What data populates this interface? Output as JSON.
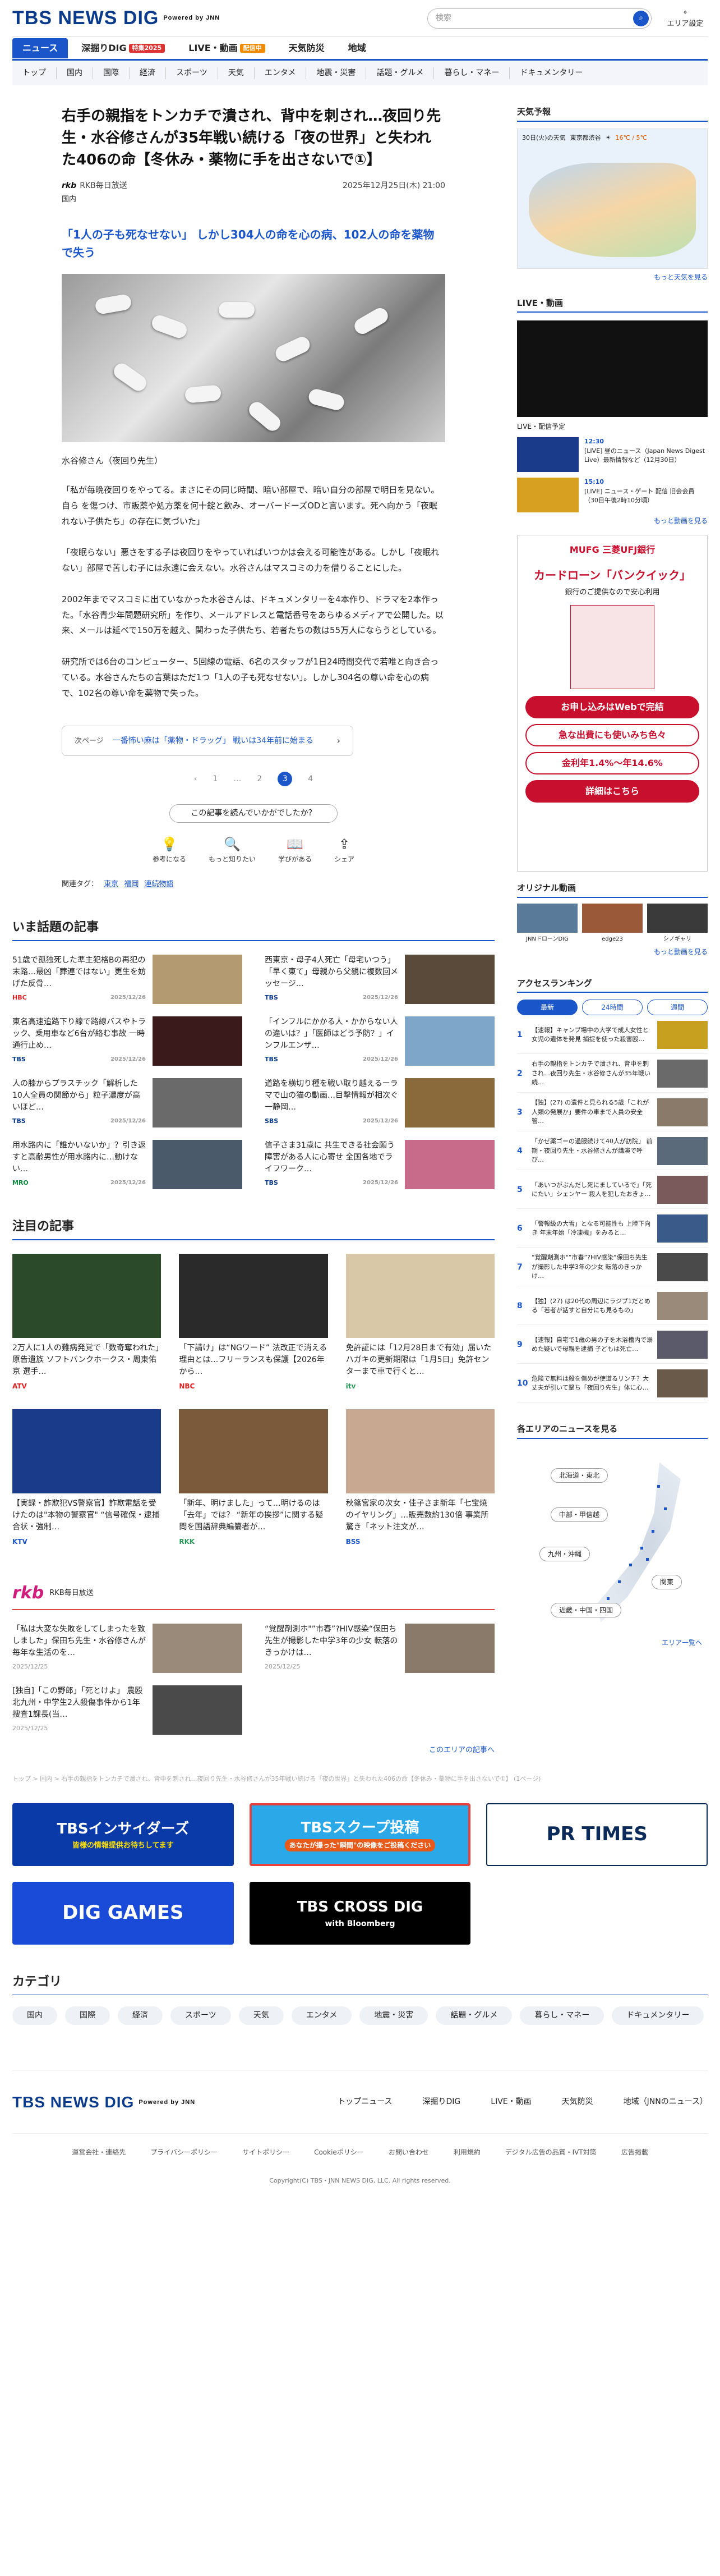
{
  "header": {
    "logo": "TBS NEWS DIG",
    "logo_sub": "Powered by JNN",
    "search_placeholder": "検索",
    "area_label": "エリア設定"
  },
  "gnav": [
    {
      "label": "ニュース",
      "badge": ""
    },
    {
      "label": "深掘りDIG",
      "badge": "特集2025"
    },
    {
      "label": "LIVE・動画",
      "badge": "配信中"
    },
    {
      "label": "天気防災",
      "badge": ""
    },
    {
      "label": "地域",
      "badge": ""
    }
  ],
  "snav": [
    "トップ",
    "国内",
    "国際",
    "経済",
    "スポーツ",
    "天気",
    "エンタメ",
    "地震・災害",
    "話題・グルメ",
    "暮らし・マネー",
    "ドキュメンタリー"
  ],
  "article": {
    "title": "右手の親指をトンカチで潰され、背中を刺され…夜回り先生・水谷修さんが35年戦い続ける「夜の世界」と失われた406の命【冬休み・薬物に手を出さないで①】",
    "source": "RKB毎日放送",
    "date": "2025年12月25日(木) 21:00",
    "category": "国内",
    "lead": "「1人の子も死なせない」 しかし304人の命を心の病、102人の命を薬物で失う",
    "caption": "水谷修さん（夜回り先生）",
    "paragraphs": [
      "「私が毎晩夜回りをやってる。まさにその同じ時間、暗い部屋で、暗い自分の部屋で明日を見ない。自ら を傷つけ、市販薬や処方薬を何十錠と飲み、オーバードーズODと言います。死へ向かう「夜眠れない子供たち」の存在に気づいた」",
      "「夜眠らない」悪さをする子は夜回りをやっていればいつかは会える可能性がある。しかし「夜眠れない」部屋で苦しむ子には永遠に会えない。水谷さんはマスコミの力を借りることにした。",
      "2002年までマスコミに出ていなかった水谷さんは、ドキュメンタリーを4本作り、ドラマを2本作った。「水谷青少年問題研究所」を作り、メールアドレスと電話番号をあらゆるメディアで公開した。以来、メールは延べで150万を越え、関わった子供たち、若者たちの数は55万人にならうとしている。",
      "研究所では6台のコンピューター、5回線の電話、6名のスタッフが1日24時間交代で若唯と向き合っている。水谷さんたちの言葉はただ1つ「1人の子も死なせない」。しかし304名の尊い命を心の病で、102名の尊い命を薬物で失った。"
    ],
    "next_label": "次ページ",
    "next_text": "一番怖い麻は「薬物・ドラッグ」 戦いは34年前に始まる",
    "pages": [
      "1",
      "2",
      "3",
      "4"
    ],
    "current_page": "3",
    "feedback": "この記事を読んでいかがでしたか？",
    "reactions": [
      "参考になる",
      "もっと知りたい",
      "学びがある",
      "シェア"
    ],
    "tags_label": "関連タグ：",
    "tags": [
      "東京",
      "福岡",
      "連続物語"
    ]
  },
  "topics": {
    "title": "いま話題の記事",
    "items": [
      {
        "title": "51歳で孤独死した準主犯格Bの再犯の末路…最凶「葬連ではない」更生を妨げた反骨…",
        "source": "HBC",
        "date": "2025/12/26"
      },
      {
        "title": "西東京・母子4人死亡「母宅いつう」「早く東て」母親から父親に複数回メッセージ…",
        "source": "TBS",
        "date": "2025/12/26"
      },
      {
        "title": "東名高速追路下り線で路線バスやトラック、乗用車など6台が絡む事故 一時通行止め…",
        "source": "TBS",
        "date": "2025/12/26"
      },
      {
        "title": "「インフルにかかる人・かからない人の違いは？」「医師はどう予防？」インフルエンザ…",
        "source": "TBS",
        "date": "2025/12/26"
      },
      {
        "title": "人の膝からプラスチック「解析した10人全員の関節から」粒子濃度が高いほど…",
        "source": "TBS",
        "date": "2025/12/26"
      },
      {
        "title": "道路を横切り種を戦い取り越えるーラマで山の猫の動画…目撃情報が相次ぐ一静岡…",
        "source": "SBS",
        "date": "2025/12/26"
      },
      {
        "title": "用水路内に「誰かいないか」？引き返すと高齢男性が用水路内に…動けない…",
        "source": "MRO",
        "date": "2025/12/26"
      },
      {
        "title": "信子さま31歳に 共生できる社会願う 障害がある人に心寄せ 全国各地でライフワーク…",
        "source": "TBS",
        "date": "2025/12/26"
      }
    ]
  },
  "featured": {
    "title": "注目の記事",
    "cards": [
      {
        "title": "2万人に1人の難病発覚で「数奇奪われた」原告遺族 ソフトバンクホークス・周東佑京 選手…",
        "source": "ATV",
        "date": "12時間前"
      },
      {
        "title": "「下請け」は“NGワード” 法改正で消える理由とは…フリーランスも保護【2026年から…",
        "source": "NBC",
        "date": "12時間前"
      },
      {
        "title": "免許証には「12月28日まで有効」届いたハガキの更新期限は「1月5日」免許センターまで車で行くと…",
        "source": "itv",
        "date": "12時間前"
      },
      {
        "title": "【実録・詐欺犯VS警察官】詐欺電話を受けたのは\"本物の警察官\" “信号確保・逮捕合状・強制…",
        "source": "KTV",
        "date": "12時間前"
      },
      {
        "title": "「新年、明けました」って…明けるのは「去年」では？ “新年の挨拶”に関する疑問を国語辞典編纂者が…",
        "source": "RKK",
        "date": "12時間前"
      },
      {
        "title": "秋篠宮家の次女・佳子さま新年「七宝焼のイヤリング」…販売数約130倍 事業所驚き「ネット注文が…",
        "source": "BSS",
        "date": "12時間前"
      }
    ]
  },
  "rkb": {
    "brand": "rkb",
    "label": "RKB毎日放送",
    "items": [
      {
        "title": "「私は大変な失敗をしてしまったを致しました」保田ち先生・水谷修さんが毎年な生活のを…",
        "date": "2025/12/25"
      },
      {
        "title": "“覚醒剤測ホ\"”市春”?HIV感染“保田ち先生が撮影した中学3年の少女 転落のきっかけは…",
        "date": "2025/12/25"
      },
      {
        "title": "[独自]「この野郎」「死とけよ」 農殴 北九州・中学生2人殺傷事件から1年 捜査1課長(当…",
        "date": "2025/12/25"
      }
    ],
    "more": "このエリアの記事へ"
  },
  "ticker": "トップ > 国内 > 右手の親指をトンカチで潰され、背中を刺され…夜回り先生・水谷修さんが35年戦い続ける「夜の世界」と失われた406の命【冬休み・薬物に手を出さないで①】 (1ページ)",
  "banners": [
    {
      "label": "TBSインサイダーズ",
      "sub": "皆様の情報提供お待ちしてます"
    },
    {
      "label": "TBSスクープ投稿",
      "sub": "あなたが撮った\"瞬間\"の映像をご投稿ください"
    },
    {
      "label": "PR TIMES",
      "sub": ""
    },
    {
      "label": "DIG GAMES",
      "sub": ""
    },
    {
      "label": "TBS CROSS DIG",
      "sub": "with Bloomberg"
    }
  ],
  "categories": {
    "title": "カテゴリ",
    "items": [
      "国内",
      "国際",
      "経済",
      "スポーツ",
      "天気",
      "エンタメ",
      "地震・災害",
      "話題・グルメ",
      "暮らし・マネー",
      "ドキュメンタリー"
    ]
  },
  "sidebar": {
    "weather_title": "天気予報",
    "weather_date": "30日(火)の天気",
    "weather_city": "東京都渋谷",
    "weather_temp": "16℃ / 5℃",
    "weather_more": "もっと天気を見る",
    "live_title": "LIVE・動画",
    "live_sub": "LIVE・配信予定",
    "live_items": [
      {
        "title": "[LIVE] 昼のニュース（Japan News Digest Live）最新情報など（12月30日）",
        "time": "12:30"
      },
      {
        "title": "[LIVE] ニュース・ゲート 配信 旧会会員（30日午後2時10分頃）",
        "time": "15:10"
      }
    ],
    "live_more": "もっと動画を見る",
    "ad_brand": "MUFG 三菱UFJ銀行",
    "ad_head": "カードローン「バンクイック」",
    "ad_sub": "銀行のご提供なので安心利用",
    "ad_btn1": "お申し込みはWebで完結",
    "ad_btn2": "急な出費にも使いみち色々",
    "ad_btn3": "金利年1.4%〜年14.6%",
    "ad_btn4": "詳細はこちら",
    "orig_title": "オリジナル動画",
    "orig_items": [
      "JNNドローンDIG",
      "edge23",
      "シノギャリ"
    ],
    "orig_more": "もっと動画を見る",
    "rank_title": "アクセスランキング",
    "rank_tabs": [
      "最新",
      "24時間",
      "週間"
    ],
    "ranks": [
      "【速報】キャンプ場中の大学で成人女性と女児の遺体を発見 捕捉を使った殺害殴…",
      "右手の親指をトンカチで潰され、背中を刺され…夜回り先生・水谷修さんが35年戦い続…",
      "【独】(27) の遺件と見られる5歳「これが人類の発展か」要件の車まで人員の安全管…",
      "「かぜ薬ゴーの過服続けて40人が訪院」 前期・夜回り先生・水谷修さんが講演で呼び…",
      "「あいつがぶんだし死にましているで」「死にたい」シェンヤー 殺人を犯したおきょ…",
      "「警報級の大雪」となる可能性も 上陸下向き 年末年始「冷凍機」をみると…",
      "“覚醒剤測ホ\"”市春”?HIV感染“保田ち先生が撮影した中学3年の少女 転落のきっかけ…",
      "【独】(27) は20代の周辺にラジプ1だとめる「若者が話すと自分にも見るもの」",
      "【速報】自宅で1歳の男の子を木浴槽内で溺めた疑いで母親を逮捕 子どもは死亡…",
      "危険で無料は殺を傷めが使道るリンチ？大丈夫が引いて撃ち「夜回り先生」体に心…"
    ],
    "area_title": "各エリアのニュースを見る",
    "area_pills": [
      "北海道・東北",
      "中部・甲信越",
      "九州・沖縄",
      "関東",
      "近畿・中国・四国"
    ],
    "area_more": "エリア一覧へ"
  },
  "footer": {
    "links": [
      "トップニュース",
      "深掘りDIG",
      "LIVE・動画",
      "天気防災",
      "地域（JNNのニュース）"
    ],
    "sub": [
      "運営会社・連絡先",
      "プライバシーポリシー",
      "サイトポリシー",
      "Cookieポリシー",
      "お問い合わせ",
      "利用規約",
      "デジタル広告の品質・IVT対策",
      "広告掲載"
    ],
    "copyright": "Copyright(C) TBS・JNN NEWS DIG, LLC. All rights reserved."
  }
}
